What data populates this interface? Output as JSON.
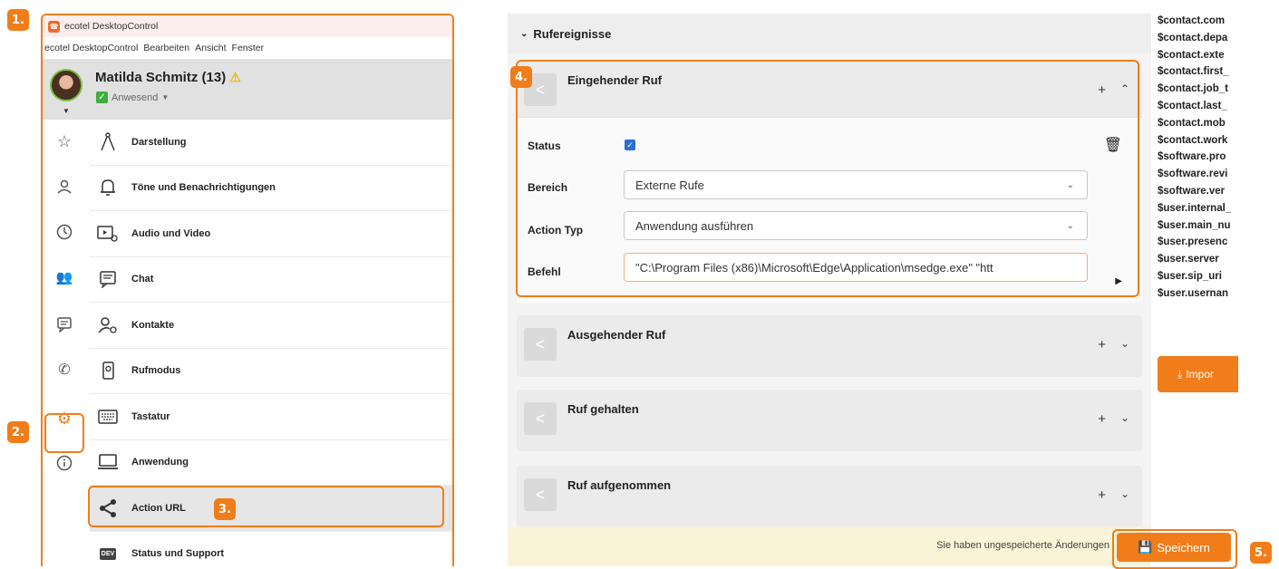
{
  "badges": [
    "1.",
    "2.",
    "3.",
    "4.",
    "5."
  ],
  "app": {
    "title": "ecotel DesktopControl",
    "menu": [
      "ecotel DesktopControl",
      "Bearbeiten",
      "Ansicht",
      "Fenster"
    ]
  },
  "profile": {
    "name": "Matilda Schmitz (13)",
    "presence": "Anwesend"
  },
  "rail_icons": [
    "star-icon",
    "user-icon",
    "clock-icon",
    "group-icon",
    "message-icon",
    "phone-icon",
    "gear-icon",
    "info-icon"
  ],
  "settings": [
    {
      "label": "Darstellung",
      "icon": "compass-icon"
    },
    {
      "label": "Töne und Benachrichtigungen",
      "icon": "bell-icon"
    },
    {
      "label": "Audio und Video",
      "icon": "video-settings-icon"
    },
    {
      "label": "Chat",
      "icon": "chat-icon"
    },
    {
      "label": "Kontakte",
      "icon": "contacts-settings-icon"
    },
    {
      "label": "Rufmodus",
      "icon": "phone-mode-icon"
    },
    {
      "label": "Tastatur",
      "icon": "keyboard-icon"
    },
    {
      "label": "Anwendung",
      "icon": "laptop-icon"
    },
    {
      "label": "Action URL",
      "icon": "share-icon"
    },
    {
      "label": "Status und Support",
      "icon": "dev-icon",
      "icon_text": "DEV"
    }
  ],
  "section": {
    "title": "Rufereignisse"
  },
  "events": [
    {
      "title": "Eingehender Ruf",
      "expanded": true
    },
    {
      "title": "Ausgehender Ruf"
    },
    {
      "title": "Ruf gehalten"
    },
    {
      "title": "Ruf aufgenommen"
    }
  ],
  "form": {
    "status_label": "Status",
    "bereich_label": "Bereich",
    "bereich_value": "Externe Rufe",
    "action_label": "Action Typ",
    "action_value": "Anwendung ausführen",
    "befehl_label": "Befehl",
    "befehl_value": "\"C:\\Program Files (x86)\\Microsoft\\Edge\\Application\\msedge.exe\" \"htt"
  },
  "savebar": {
    "unsaved_text": "Sie haben ungespeicherte Änderungen",
    "save_label": "Speichern"
  },
  "variables": [
    "$contact.com",
    "$contact.depa",
    "$contact.exte",
    "$contact.first_",
    "$contact.job_t",
    "$contact.last_",
    "$contact.mob",
    "$contact.work",
    "$software.pro",
    "$software.revi",
    "$software.ver",
    "$user.internal_",
    "$user.main_nu",
    "$user.presenc",
    "$user.server",
    "$user.sip_uri",
    "$user.usernan"
  ],
  "import_label": "Impor",
  "colors": {
    "accent": "#f07d1a",
    "checkbox": "#2b6fd3",
    "presence": "#3fae3f"
  }
}
